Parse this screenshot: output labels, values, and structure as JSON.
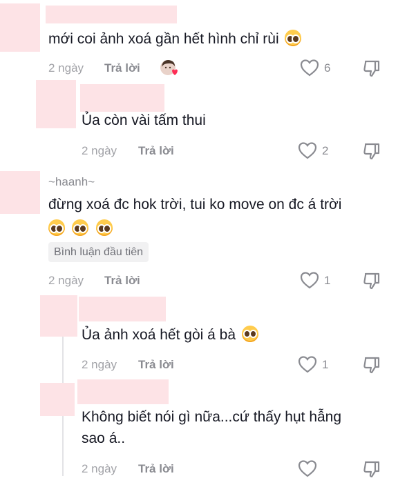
{
  "comments": [
    {
      "text": "mới coi ảnh xoá gần hết hình chỉ rùi",
      "emoji": "pleading-face",
      "date": "2 ngày",
      "reply_label": "Trả lời",
      "likes": "6"
    },
    {
      "text": "Ủa còn vài tấm thui",
      "date": "2 ngày",
      "reply_label": "Trả lời",
      "likes": "2"
    },
    {
      "username": "~haanh~",
      "text": "đừng xoá đc hok trời, tui ko move on đc á trời",
      "emojis": [
        "pleading-face",
        "pleading-face",
        "pleading-face"
      ],
      "badge": "Bình luận đầu tiên",
      "date": "2 ngày",
      "reply_label": "Trả lời",
      "likes": "1"
    },
    {
      "text": "Ủa ảnh xoá hết gòi á bà",
      "emoji": "flushed-face",
      "date": "2 ngày",
      "reply_label": "Trả lời",
      "likes": "1"
    },
    {
      "text_line1": "Không biết nói gì nữa...cứ thấy hụt hẫng",
      "text_line2": "sao á..",
      "date": "2 ngày",
      "reply_label": "Trả lời",
      "likes": ""
    }
  ],
  "colors": {
    "like_red": "#fe2c55",
    "text": "#161823",
    "muted": "#a1a2a7"
  }
}
